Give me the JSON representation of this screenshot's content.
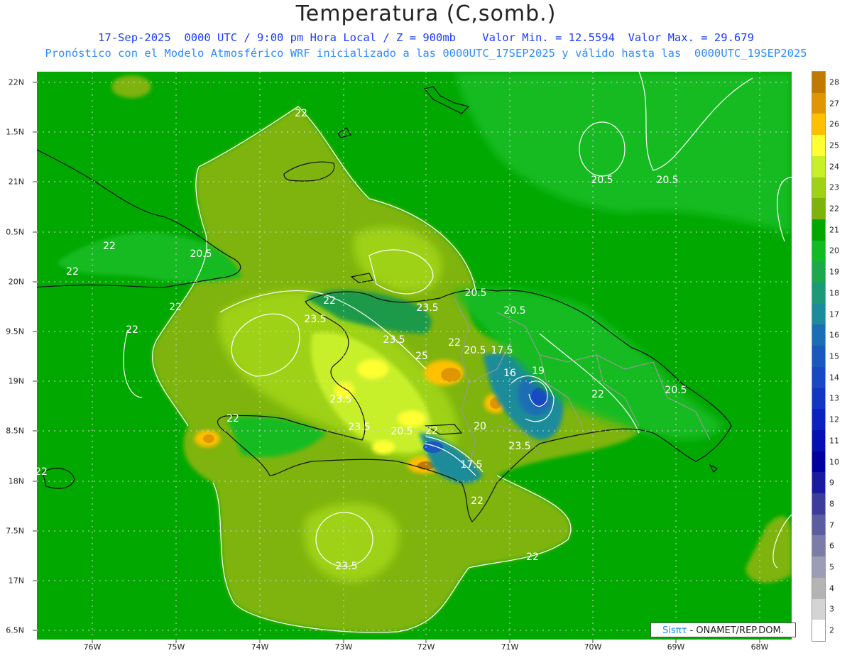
{
  "title": "Temperatura (C,somb.)",
  "subtitle_line1": "17-Sep-2025  0000 UTC / 9:00 pm Hora Local / Z = 900mb    Valor Min. = 12.5594  Valor Max. = 29.679",
  "subtitle_line2": "Pronóstico con el Modelo Atmosférico WRF inicializado a las 0000UTC_17SEP2025 y válido hasta las  0000UTC_19SEP2025",
  "credit": {
    "logo": "Sisπτ",
    "text": "- ONAMET/REP.DOM."
  },
  "y_axis_labels": [
    "22N",
    "1.5N",
    "21N",
    "0.5N",
    "20N",
    "9.5N",
    "19N",
    "8.5N",
    "18N",
    "7.5N",
    "17N",
    "6.5N"
  ],
  "x_axis_labels": [
    "76W",
    "75W",
    "74W",
    "73W",
    "72W",
    "71W",
    "70W",
    "69W",
    "68W"
  ],
  "colorbar": {
    "labels": [
      "28",
      "27",
      "26",
      "25",
      "24",
      "23",
      "22",
      "21",
      "20",
      "19",
      "18",
      "17",
      "16",
      "15",
      "14",
      "13",
      "12",
      "11",
      "10",
      "9",
      "8",
      "7",
      "6",
      "5",
      "4",
      "3",
      "2"
    ],
    "colors": [
      "#c07a00",
      "#e09600",
      "#ffc000",
      "#ffff33",
      "#c8f02a",
      "#9ed214",
      "#7eb40a",
      "#00a800",
      "#12bb24",
      "#1ea84c",
      "#1c9a78",
      "#1a8c9a",
      "#1a6eb4",
      "#1a58c0",
      "#1848c4",
      "#1236c4",
      "#0a22c0",
      "#0410b4",
      "#0000a0",
      "#1a1aa0",
      "#3c3c9c",
      "#5c5ca0",
      "#7c7ca8",
      "#9c9cb4",
      "#b4b4b4",
      "#d4d4d4",
      "#ffffff"
    ]
  },
  "contour_labels": [
    {
      "text": "22"
    },
    {
      "text": "22"
    },
    {
      "text": "20.5"
    },
    {
      "text": "22"
    },
    {
      "text": "22"
    },
    {
      "text": "22"
    },
    {
      "text": "23.5"
    },
    {
      "text": "23.5"
    },
    {
      "text": "23.5"
    },
    {
      "text": "25"
    },
    {
      "text": "22"
    },
    {
      "text": "20.5"
    },
    {
      "text": "17.5"
    },
    {
      "text": "16"
    },
    {
      "text": "19"
    },
    {
      "text": "22"
    },
    {
      "text": "20.5"
    },
    {
      "text": "20.5"
    },
    {
      "text": "20.5"
    },
    {
      "text": "22"
    },
    {
      "text": "23.5"
    },
    {
      "text": "22"
    },
    {
      "text": "23.5"
    },
    {
      "text": "20.5"
    },
    {
      "text": "22"
    },
    {
      "text": "20"
    },
    {
      "text": "23.5"
    },
    {
      "text": "17.5"
    },
    {
      "text": "22"
    },
    {
      "text": "22"
    },
    {
      "text": "23.5"
    },
    {
      "text": "22"
    },
    {
      "text": "20.5"
    },
    {
      "text": "20.5"
    }
  ]
}
